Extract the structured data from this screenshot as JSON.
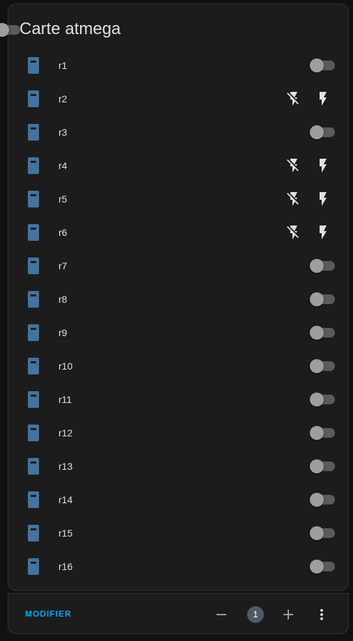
{
  "card": {
    "title": "Carte atmega"
  },
  "rows": [
    {
      "label": "r1",
      "control": "toggle"
    },
    {
      "label": "r2",
      "control": "buttons"
    },
    {
      "label": "r3",
      "control": "toggle"
    },
    {
      "label": "r4",
      "control": "buttons"
    },
    {
      "label": "r5",
      "control": "buttons"
    },
    {
      "label": "r6",
      "control": "buttons"
    },
    {
      "label": "r7",
      "control": "toggle"
    },
    {
      "label": "r8",
      "control": "toggle"
    },
    {
      "label": "r9",
      "control": "toggle"
    },
    {
      "label": "r10",
      "control": "toggle"
    },
    {
      "label": "r11",
      "control": "toggle"
    },
    {
      "label": "r12",
      "control": "toggle"
    },
    {
      "label": "r13",
      "control": "toggle"
    },
    {
      "label": "r14",
      "control": "toggle"
    },
    {
      "label": "r15",
      "control": "toggle"
    },
    {
      "label": "r16",
      "control": "toggle"
    }
  ],
  "footer": {
    "edit_label": "MODIFIER",
    "badge_count": "1"
  },
  "colors": {
    "accent": "#03a9f4",
    "switch_icon": "#44739e",
    "card_bg": "#1c1c1c",
    "page_bg": "#111111"
  },
  "icons": {
    "row_icon": "light-switch-icon",
    "off_button": "flash-off-icon",
    "on_button": "flash-icon"
  }
}
